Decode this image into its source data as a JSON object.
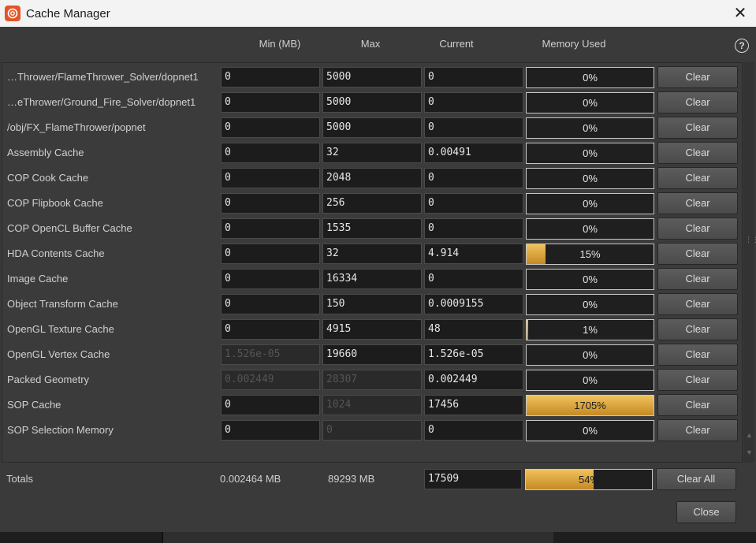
{
  "window": {
    "title": "Cache Manager"
  },
  "columns": {
    "min": "Min (MB)",
    "max": "Max",
    "current": "Current",
    "memory": "Memory Used"
  },
  "rows": [
    {
      "label": "…Thrower/FlameThrower_Solver/dopnet1",
      "min": "0",
      "max": "5000",
      "current": "0",
      "pct": "0%",
      "fill": 0,
      "clear": "Clear"
    },
    {
      "label": "…eThrower/Ground_Fire_Solver/dopnet1",
      "min": "0",
      "max": "5000",
      "current": "0",
      "pct": "0%",
      "fill": 0,
      "clear": "Clear"
    },
    {
      "label": "/obj/FX_FlameThrower/popnet",
      "min": "0",
      "max": "5000",
      "current": "0",
      "pct": "0%",
      "fill": 0,
      "clear": "Clear"
    },
    {
      "label": "Assembly Cache",
      "min": "0",
      "max": "32",
      "current": "0.00491",
      "pct": "0%",
      "fill": 0,
      "clear": "Clear"
    },
    {
      "label": "COP Cook Cache",
      "min": "0",
      "max": "2048",
      "current": "0",
      "pct": "0%",
      "fill": 0,
      "clear": "Clear"
    },
    {
      "label": "COP Flipbook Cache",
      "min": "0",
      "max": "256",
      "current": "0",
      "pct": "0%",
      "fill": 0,
      "clear": "Clear"
    },
    {
      "label": "COP OpenCL Buffer Cache",
      "min": "0",
      "max": "1535",
      "current": "0",
      "pct": "0%",
      "fill": 0,
      "clear": "Clear"
    },
    {
      "label": "HDA Contents Cache",
      "min": "0",
      "max": "32",
      "current": "4.914",
      "pct": "15%",
      "fill": 15,
      "clear": "Clear"
    },
    {
      "label": "Image Cache",
      "min": "0",
      "max": "16334",
      "current": "0",
      "pct": "0%",
      "fill": 0,
      "clear": "Clear"
    },
    {
      "label": "Object Transform Cache",
      "min": "0",
      "max": "150",
      "current": "0.0009155",
      "pct": "0%",
      "fill": 0,
      "clear": "Clear"
    },
    {
      "label": "OpenGL Texture Cache",
      "min": "0",
      "max": "4915",
      "current": "48",
      "pct": "1%",
      "fill": 1,
      "clear": "Clear"
    },
    {
      "label": "OpenGL Vertex Cache",
      "min": "1.526e-05",
      "minDisabled": true,
      "max": "19660",
      "current": "1.526e-05",
      "pct": "0%",
      "fill": 0,
      "clear": "Clear"
    },
    {
      "label": "Packed Geometry",
      "min": "0.002449",
      "minDisabled": true,
      "max": "28307",
      "maxDisabled": true,
      "current": "0.002449",
      "pct": "0%",
      "fill": 0,
      "clear": "Clear"
    },
    {
      "label": "SOP Cache",
      "min": "0",
      "max": "1024",
      "maxDisabled": true,
      "current": "17456",
      "pct": "1705%",
      "fill": 100,
      "clear": "Clear"
    },
    {
      "label": "SOP Selection Memory",
      "min": "0",
      "max": "0",
      "maxDisabled": true,
      "current": "0",
      "pct": "0%",
      "fill": 0,
      "clear": "Clear"
    }
  ],
  "totals": {
    "label": "Totals",
    "min": "0.002464 MB",
    "max": "89293 MB",
    "current": "17509",
    "pct": "54%",
    "fill": 54,
    "clear_all": "Clear All"
  },
  "close_label": "Close",
  "colors": {
    "accent": "#e0a73a",
    "panel": "#3a3a3a",
    "field": "#1c1c1c"
  }
}
